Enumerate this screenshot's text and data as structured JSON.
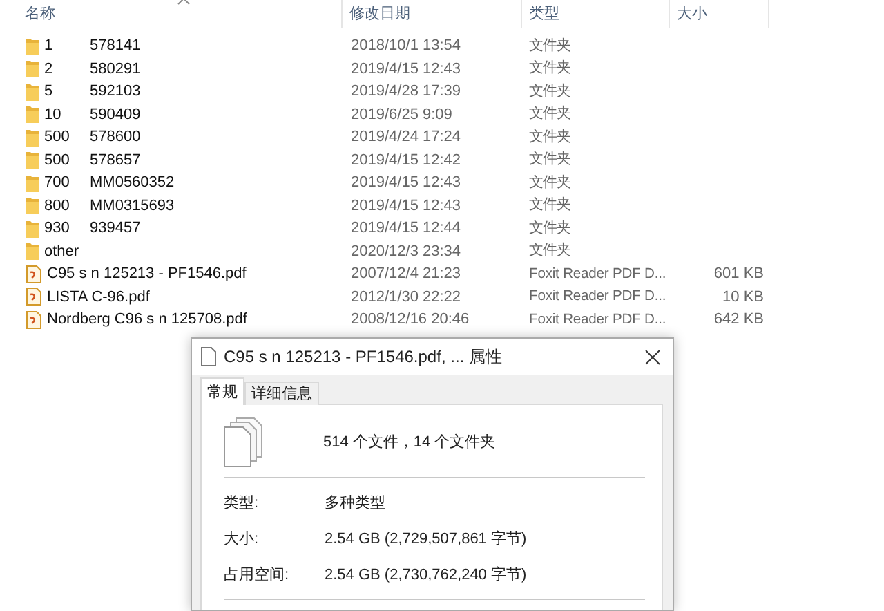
{
  "columns": [
    "名称",
    "修改日期",
    "类型",
    "大小"
  ],
  "files": [
    {
      "kind": "folder",
      "name": "1",
      "code": "578141",
      "modified": "2018/10/1 13:54",
      "type": "文件夹"
    },
    {
      "kind": "folder",
      "name": "2",
      "code": "580291",
      "modified": "2019/4/15 12:43",
      "type": "文件夹"
    },
    {
      "kind": "folder",
      "name": "5",
      "code": "592103",
      "modified": "2019/4/28 17:39",
      "type": "文件夹"
    },
    {
      "kind": "folder",
      "name": "10",
      "code": "590409",
      "modified": "2019/6/25 9:09",
      "type": "文件夹"
    },
    {
      "kind": "folder",
      "name": "500",
      "code": "578600",
      "modified": "2019/4/24 17:24",
      "type": "文件夹"
    },
    {
      "kind": "folder",
      "name": "500",
      "code": "578657",
      "modified": "2019/4/15 12:42",
      "type": "文件夹"
    },
    {
      "kind": "folder",
      "name": "700",
      "code": "MM0560352",
      "modified": "2019/4/15 12:43",
      "type": "文件夹"
    },
    {
      "kind": "folder",
      "name": "800",
      "code": "MM0315693",
      "modified": "2019/4/15 12:43",
      "type": "文件夹"
    },
    {
      "kind": "folder",
      "name": "930",
      "code": "939457",
      "modified": "2019/4/15 12:44",
      "type": "文件夹"
    },
    {
      "kind": "folder",
      "name": "other",
      "modified": "2020/12/3 23:34",
      "type": "文件夹"
    },
    {
      "kind": "pdf",
      "name": "C95 s n 125213 - PF1546.pdf",
      "modified": "2007/12/4 21:23",
      "type": "Foxit Reader PDF D...",
      "size": "601 KB"
    },
    {
      "kind": "pdf",
      "name": "LISTA C-96.pdf",
      "modified": "2012/1/30 22:22",
      "type": "Foxit Reader PDF D...",
      "size": "10 KB"
    },
    {
      "kind": "pdf",
      "name": "Nordberg C96 s n 125708.pdf",
      "modified": "2008/12/16 20:46",
      "type": "Foxit Reader PDF D...",
      "size": "642 KB"
    }
  ],
  "dialog": {
    "title": "C95 s n 125213 - PF1546.pdf, ... 属性",
    "tabs": [
      {
        "label": "常规",
        "selected": true
      },
      {
        "label": "详细信息",
        "selected": false
      }
    ],
    "summary": "514 个文件，14 个文件夹",
    "properties": [
      {
        "label": "类型:",
        "value": "多种类型"
      },
      {
        "label": "大小:",
        "value": "2.54 GB (2,729,507,861 字节)"
      },
      {
        "label": "占用空间:",
        "value": "2.54 GB (2,730,762,240 字节)"
      }
    ]
  }
}
